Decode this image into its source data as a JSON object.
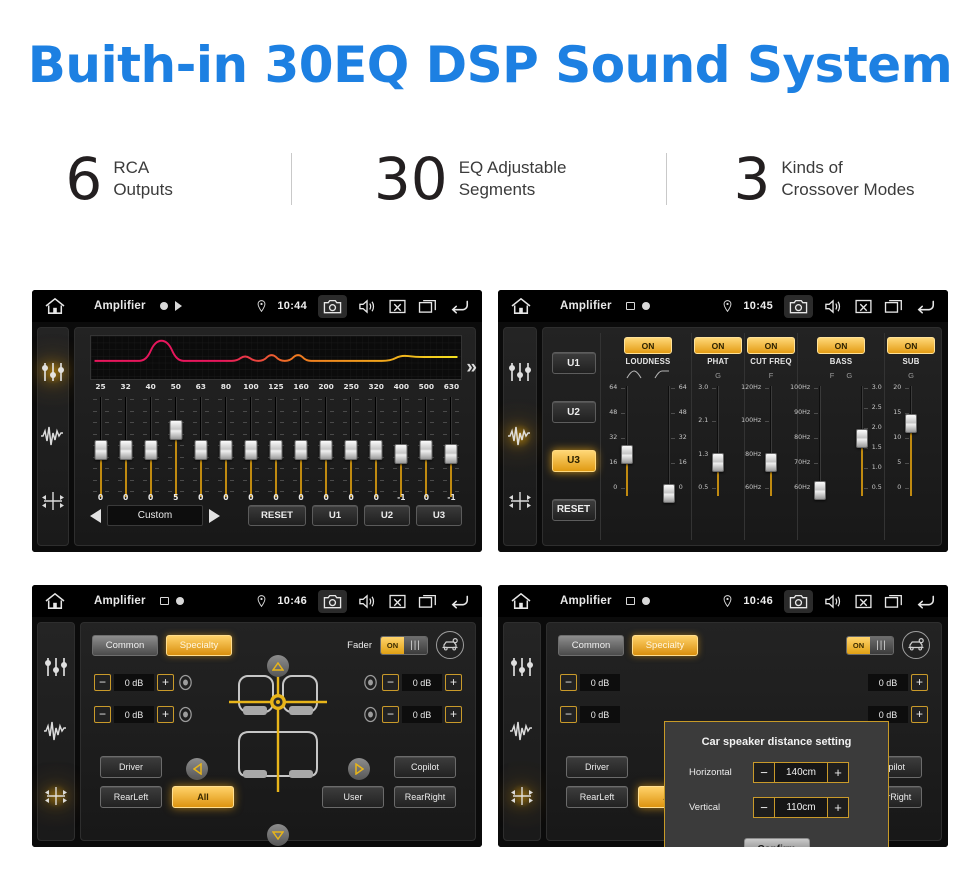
{
  "header": {
    "title": "Buith-in 30EQ DSP Sound System",
    "title_color": "#1d80e2",
    "stats": [
      {
        "number": "6",
        "line1": "RCA",
        "line2": "Outputs"
      },
      {
        "number": "30",
        "line1": "EQ Adjustable",
        "line2": "Segments"
      },
      {
        "number": "3",
        "line1": "Kinds of",
        "line2": "Crossover Modes"
      }
    ]
  },
  "panel1": {
    "statusbar": {
      "title": "Amplifier",
      "time": "10:44",
      "icons": [
        "home-icon",
        "record-dot-icon",
        "play-flag-icon",
        "location-pin-icon",
        "camera-icon",
        "volume-icon",
        "close-box-icon",
        "recents-icon",
        "back-icon"
      ]
    },
    "sidebar": [
      {
        "name": "equalizer-icon",
        "active": true
      },
      {
        "name": "waveform-icon",
        "active": false
      },
      {
        "name": "balance-icon",
        "active": false
      }
    ],
    "eq": {
      "frequencies": [
        "25",
        "32",
        "40",
        "50",
        "63",
        "80",
        "100",
        "125",
        "160",
        "200",
        "250",
        "320",
        "400",
        "500",
        "630"
      ],
      "values": [
        0,
        0,
        0,
        5,
        0,
        0,
        0,
        0,
        0,
        0,
        0,
        0,
        -1,
        0,
        -1
      ],
      "curve_colors": [
        "#e8165c",
        "#f07820",
        "#f2d520"
      ],
      "more_icon": "»"
    },
    "controls": {
      "prev_icon": "prev-arrow-icon",
      "preset": "Custom",
      "next_icon": "next-arrow-icon",
      "reset": "RESET",
      "presets": [
        "U1",
        "U2",
        "U3"
      ]
    }
  },
  "panel2": {
    "statusbar": {
      "title": "Amplifier",
      "time": "10:45"
    },
    "sidebar": [
      {
        "name": "equalizer-icon",
        "active": false
      },
      {
        "name": "waveform-icon",
        "active": true
      },
      {
        "name": "balance-icon",
        "active": false
      }
    ],
    "user_presets": [
      {
        "label": "U1",
        "selected": false
      },
      {
        "label": "U2",
        "selected": false
      },
      {
        "label": "U3",
        "selected": true
      }
    ],
    "reset_label": "RESET",
    "effects": [
      {
        "name": "LOUDNESS",
        "state": "ON",
        "headers": [
          "curve-down-icon",
          "curve-up-icon"
        ],
        "sliders": [
          {
            "labels_left": [
              "64",
              "48",
              "32",
              "16",
              "0"
            ],
            "labels_right": [],
            "value_pct": 42
          },
          {
            "labels_left": [],
            "labels_right": [
              "64",
              "48",
              "32",
              "16",
              "0"
            ],
            "value_pct": 4
          }
        ]
      },
      {
        "name": "PHAT",
        "state": "ON",
        "headers": [
          "G"
        ],
        "sliders": [
          {
            "labels_left": [
              "3.0",
              "2.1",
              "1.3",
              "0.5"
            ],
            "labels_right": [],
            "value_pct": 34
          }
        ]
      },
      {
        "name": "CUT FREQ",
        "state": "ON",
        "headers": [
          "F"
        ],
        "sliders": [
          {
            "labels_left": [
              "120Hz",
              "100Hz",
              "80Hz",
              "60Hz"
            ],
            "labels_right": [],
            "value_pct": 34
          }
        ]
      },
      {
        "name": "BASS",
        "state": "ON",
        "headers": [
          "F",
          "G"
        ],
        "sliders": [
          {
            "labels_left": [
              "100Hz",
              "90Hz",
              "80Hz",
              "70Hz",
              "60Hz"
            ],
            "labels_right": [],
            "value_pct": 7
          },
          {
            "labels_left": [],
            "labels_right": [
              "3.0",
              "2.5",
              "2.0",
              "1.5",
              "1.0",
              "0.5"
            ],
            "value_pct": 58
          }
        ]
      },
      {
        "name": "SUB",
        "state": "ON",
        "headers": [
          "G"
        ],
        "sliders": [
          {
            "labels_left": [
              "20",
              "15",
              "10",
              "5",
              "0"
            ],
            "labels_right": [],
            "value_pct": 73
          }
        ]
      }
    ]
  },
  "panel3": {
    "statusbar": {
      "title": "Amplifier",
      "time": "10:46"
    },
    "sidebar": [
      {
        "name": "equalizer-icon",
        "active": false
      },
      {
        "name": "waveform-icon",
        "active": false
      },
      {
        "name": "balance-icon",
        "active": true
      }
    ],
    "tabs": [
      {
        "label": "Common",
        "selected": false
      },
      {
        "label": "Specialty",
        "selected": true
      }
    ],
    "fader": {
      "label": "Fader",
      "state_on": "ON",
      "car_settings_icon": "car-settings-icon"
    },
    "steppers": [
      {
        "position": "front-left",
        "minus": "−",
        "value": "0 dB",
        "plus": "+"
      },
      {
        "position": "front-right",
        "minus": "−",
        "value": "0 dB",
        "plus": "+"
      },
      {
        "position": "rear-left",
        "minus": "−",
        "value": "0 dB",
        "plus": "+"
      },
      {
        "position": "rear-right",
        "minus": "−",
        "value": "0 dB",
        "plus": "+"
      }
    ],
    "seat_buttons": [
      {
        "label": "Driver",
        "selected": false
      },
      {
        "label": "Copilot",
        "selected": false
      },
      {
        "label": "RearLeft",
        "selected": false
      },
      {
        "label": "All",
        "selected": true
      },
      {
        "label": "User",
        "selected": false
      },
      {
        "label": "RearRight",
        "selected": false
      }
    ],
    "nav_icons": [
      "up-arrow-icon",
      "left-arrow-icon",
      "right-arrow-icon",
      "down-arrow-icon"
    ]
  },
  "panel4": {
    "statusbar": {
      "title": "Amplifier",
      "time": "10:46"
    },
    "dialog": {
      "title": "Car speaker distance setting",
      "rows": [
        {
          "label": "Horizontal",
          "minus": "−",
          "value": "140cm",
          "plus": "+"
        },
        {
          "label": "Vertical",
          "minus": "−",
          "value": "110cm",
          "plus": "+"
        }
      ],
      "confirm": "Confirm",
      "border_color": "#c79a27"
    }
  },
  "colors": {
    "accent_gold": "#e3a018",
    "panel_bg": "#1d1d1d",
    "screen_black": "#070707",
    "slider_fill": "#c08a10"
  }
}
